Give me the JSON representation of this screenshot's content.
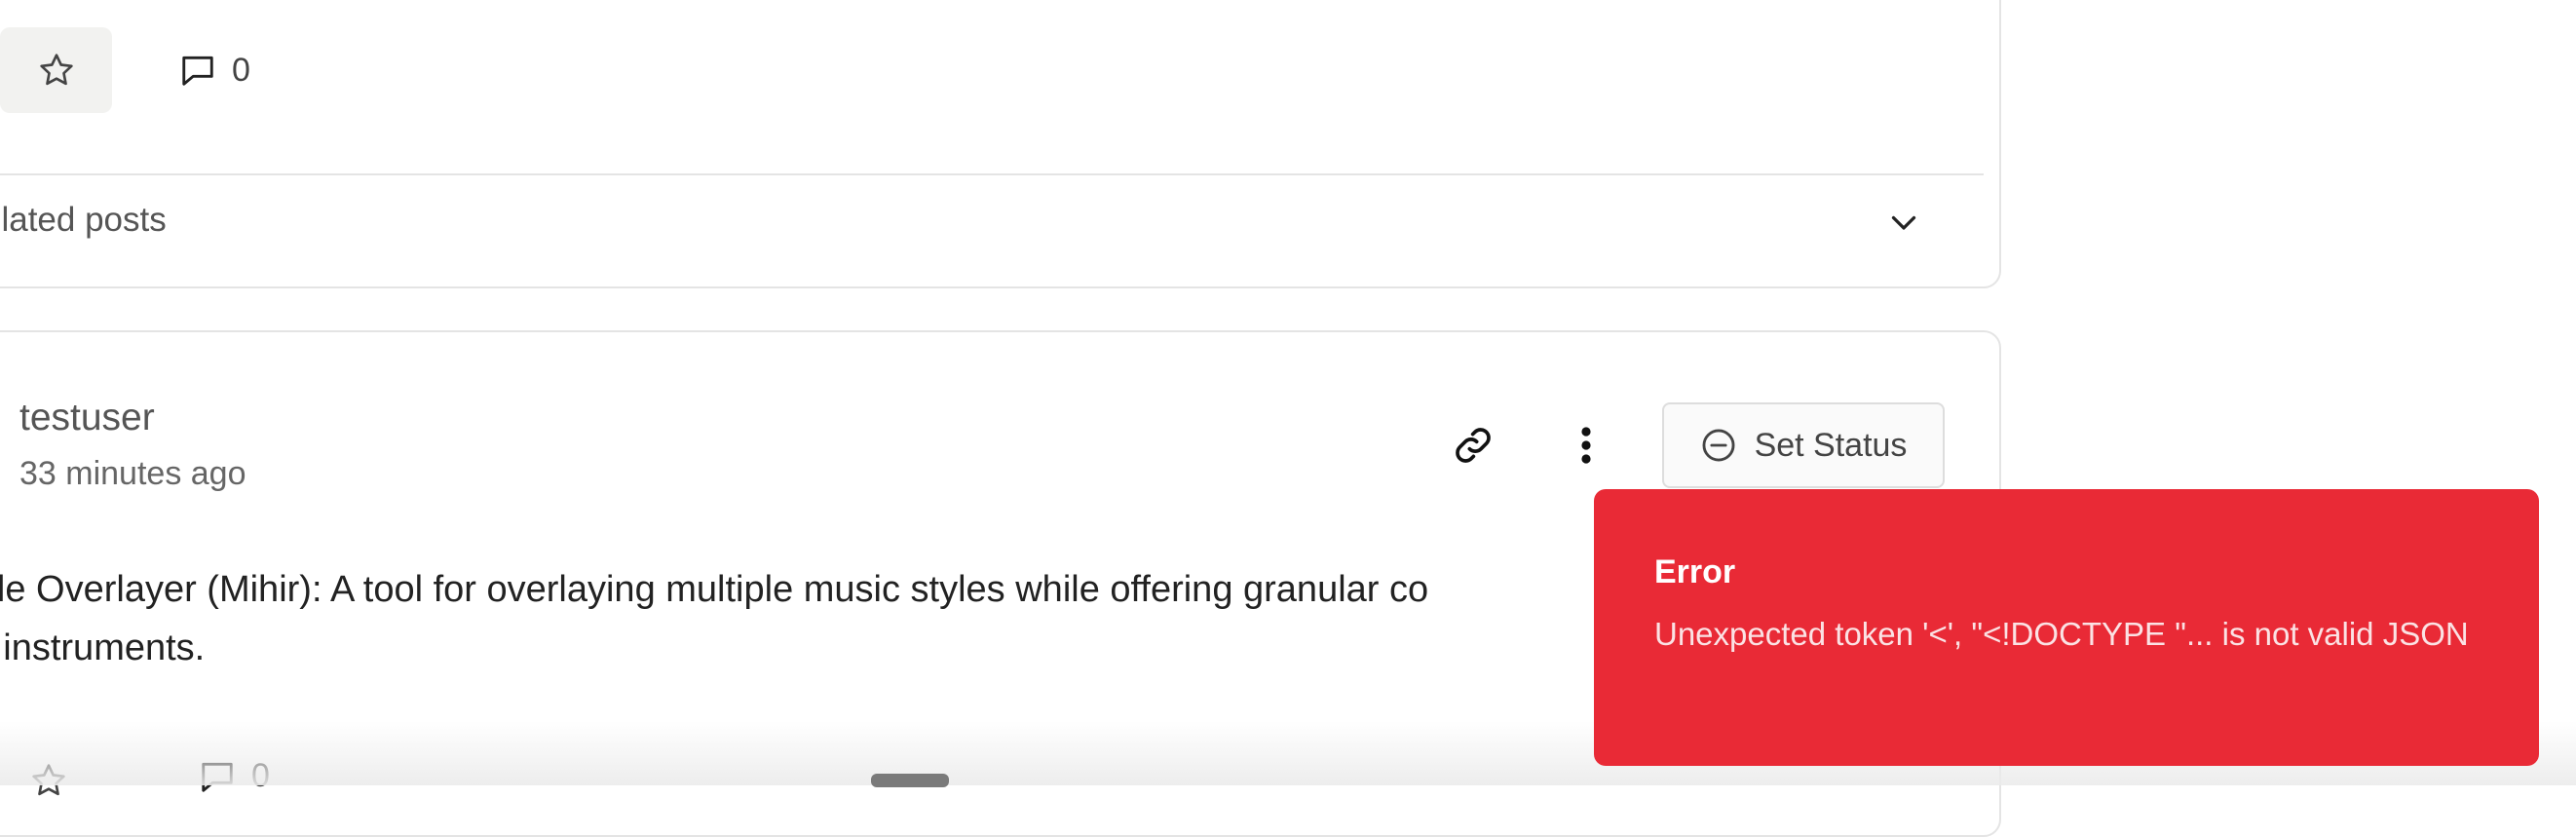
{
  "top_post": {
    "comment_count": "0",
    "related_label": "elated posts"
  },
  "post": {
    "author": "testuser",
    "time": "33 minutes ago",
    "set_status_label": "Set Status",
    "body_line1": "Style Overlayer (Mihir): A tool for overlaying multiple music styles while offering granular co",
    "body_line2": "ual instruments.",
    "comment_count": "0"
  },
  "toast": {
    "title": "Error",
    "message": "Unexpected token '<', \"<!DOCTYPE \"... is not valid JSON"
  },
  "icons": {
    "star": "star-icon",
    "comment": "comment-icon",
    "chevron": "chevron-down-icon",
    "link": "link-icon",
    "more": "more-vertical-icon",
    "status": "minus-circle-icon"
  },
  "colors": {
    "toast_bg": "#e92a36",
    "border": "#e4e4e4",
    "star_btn_bg": "#f2f2f0"
  }
}
